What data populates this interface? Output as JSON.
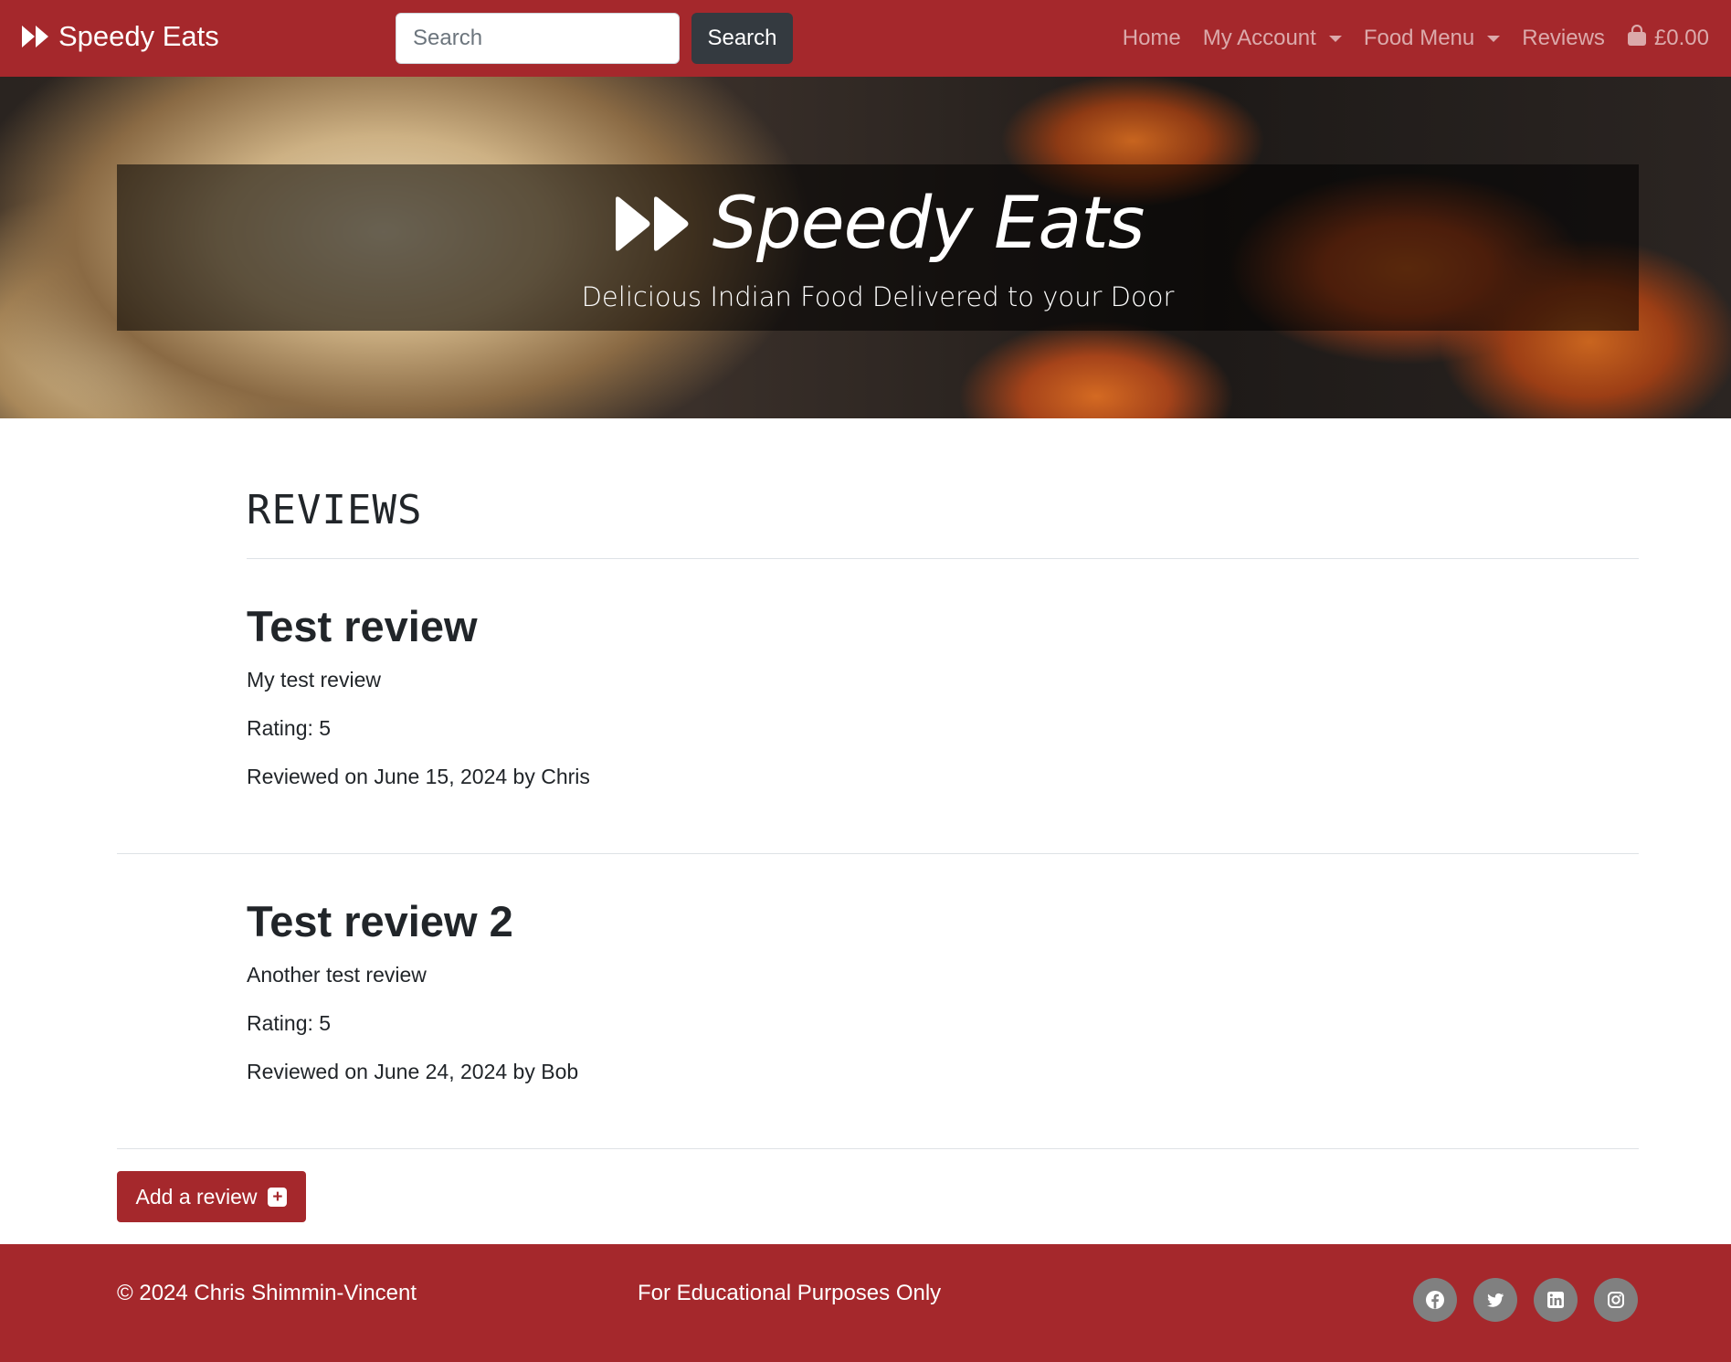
{
  "navbar": {
    "brand": "Speedy Eats",
    "search_placeholder": "Search",
    "search_button": "Search",
    "links": {
      "home": "Home",
      "my_account": "My Account",
      "food_menu": "Food Menu",
      "reviews": "Reviews",
      "basket_total": "£0.00"
    }
  },
  "hero": {
    "title": "Speedy Eats",
    "subtitle": "Delicious Indian Food Delivered to your Door"
  },
  "reviews": {
    "heading": "REVIEWS",
    "items": [
      {
        "title": "Test review",
        "body": "My test review",
        "rating": "Rating: 5",
        "meta": "Reviewed on June 15, 2024 by Chris"
      },
      {
        "title": "Test review 2",
        "body": "Another test review",
        "rating": "Rating: 5",
        "meta": "Reviewed on June 24, 2024 by Bob"
      }
    ],
    "add_button": "Add a review"
  },
  "footer": {
    "copyright": "© 2024 Chris Shimmin-Vincent",
    "note": "For Educational Purposes Only",
    "social_icons": [
      "facebook-icon",
      "twitter-icon",
      "linkedin-icon",
      "instagram-icon"
    ]
  },
  "colors": {
    "brand": "#a5282c",
    "dark_button": "#343a40",
    "social_bg": "#808080"
  }
}
